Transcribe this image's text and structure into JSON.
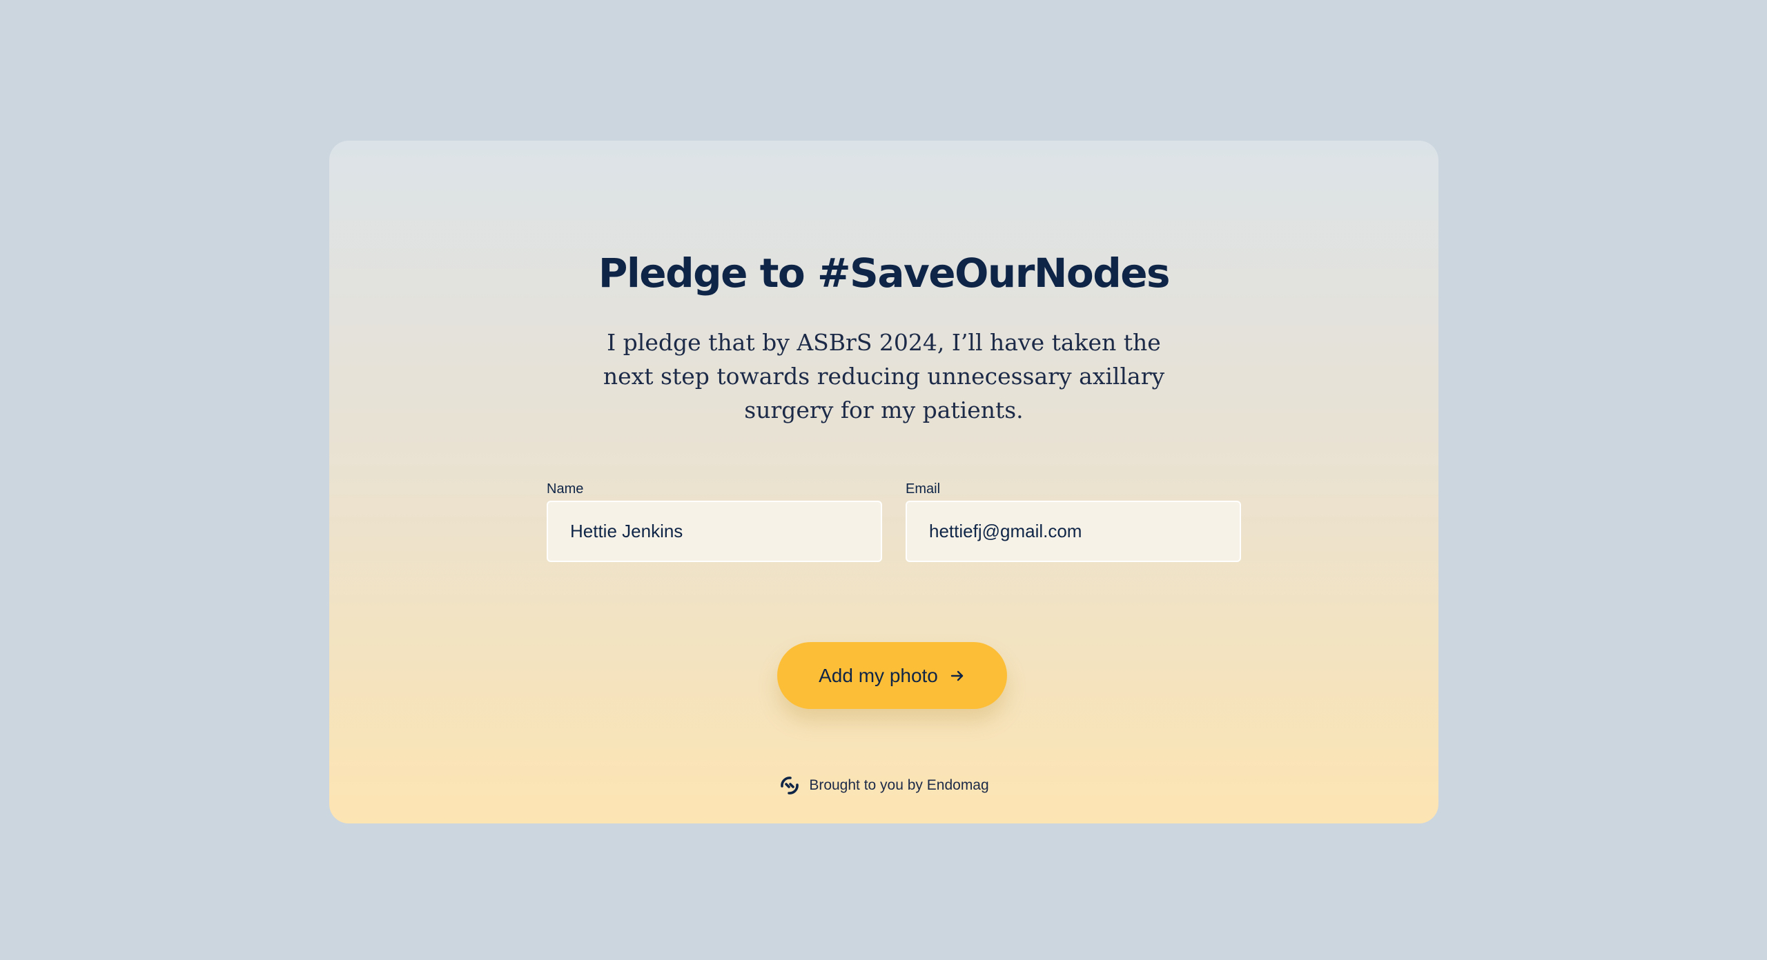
{
  "pledge": {
    "title": "Pledge to #SaveOurNodes",
    "statement": "I pledge that by ASBrS 2024, I’ll have taken the next step towards reducing unnecessary axillary surgery for my patients."
  },
  "form": {
    "name": {
      "label": "Name",
      "value": "Hettie Jenkins"
    },
    "email": {
      "label": "Email",
      "value": "hettiefj@gmail.com"
    },
    "submit_label": "Add my photo",
    "submit_icon": "arrow-right-icon"
  },
  "footer": {
    "text": "Brought to you by Endomag",
    "logo_icon": "endomag-logo-icon"
  },
  "colors": {
    "background": "#cbd6df",
    "accent": "#fdbe37",
    "text": "#0f2547"
  }
}
